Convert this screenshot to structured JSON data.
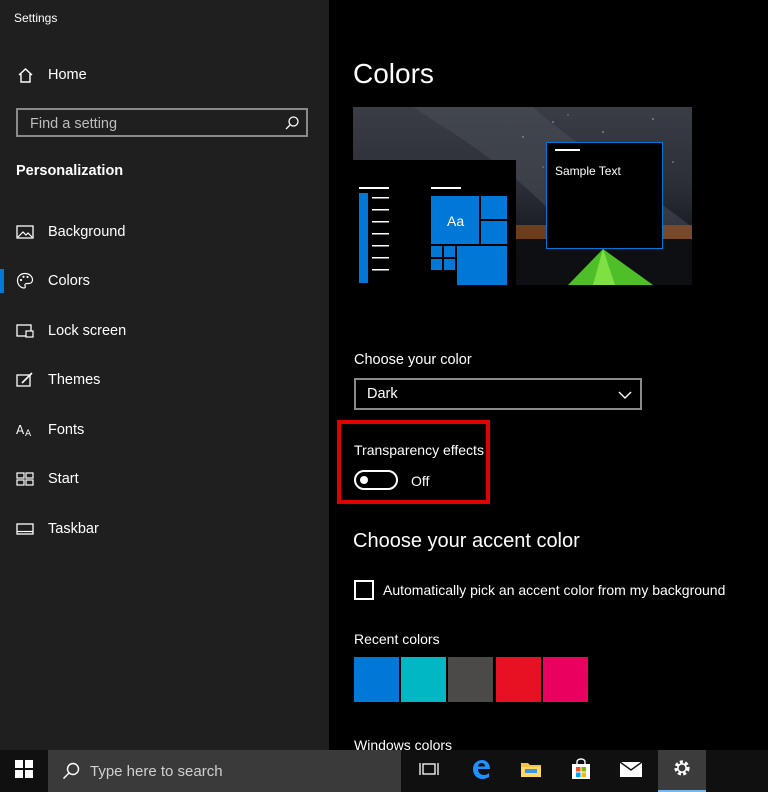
{
  "window": {
    "title": "Settings"
  },
  "sidebar": {
    "home_label": "Home",
    "search_placeholder": "Find a setting",
    "section_title": "Personalization",
    "items": [
      {
        "label": "Background",
        "icon": "picture-icon"
      },
      {
        "label": "Colors",
        "icon": "palette-icon",
        "active": true
      },
      {
        "label": "Lock screen",
        "icon": "lock-screen-icon"
      },
      {
        "label": "Themes",
        "icon": "themes-icon"
      },
      {
        "label": "Fonts",
        "icon": "fonts-icon"
      },
      {
        "label": "Start",
        "icon": "start-tiles-icon"
      },
      {
        "label": "Taskbar",
        "icon": "taskbar-icon"
      }
    ]
  },
  "main": {
    "title": "Colors",
    "preview": {
      "sample_text": "Sample Text",
      "tile_label": "Aa"
    },
    "choose_color": {
      "label": "Choose your color",
      "selected": "Dark"
    },
    "transparency": {
      "label": "Transparency effects",
      "state": "Off"
    },
    "accent": {
      "heading": "Choose your accent color",
      "auto_pick_label": "Automatically pick an accent color from my background",
      "recent_label": "Recent colors",
      "recent_colors": [
        "#0078d7",
        "#00b7c3",
        "#4c4a48",
        "#e81123",
        "#ea005e"
      ],
      "windows_colors_label": "Windows colors"
    }
  },
  "taskbar": {
    "search_placeholder": "Type here to search",
    "icons": [
      "start-icon",
      "task-view-icon",
      "edge-icon",
      "file-explorer-icon",
      "store-icon",
      "mail-icon",
      "settings-icon"
    ]
  },
  "colors": {
    "accent": "#0078d7",
    "highlight": "#e00000",
    "sidebar_bg": "#1f1f1f"
  }
}
